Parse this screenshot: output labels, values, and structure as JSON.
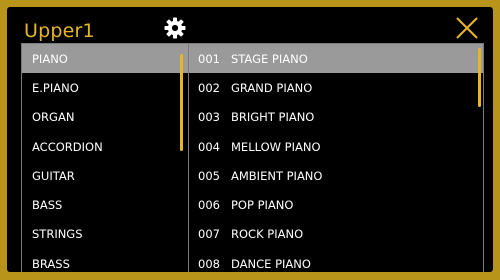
{
  "header": {
    "title": "Upper1",
    "settings_icon": "gear-icon",
    "close_icon": "close-icon",
    "accent_color": "#e6b627"
  },
  "categories": {
    "selected_index": 0,
    "items": [
      {
        "label": "PIANO"
      },
      {
        "label": "E.PIANO"
      },
      {
        "label": "ORGAN"
      },
      {
        "label": "ACCORDION"
      },
      {
        "label": "GUITAR"
      },
      {
        "label": "BASS"
      },
      {
        "label": "STRINGS"
      },
      {
        "label": "BRASS"
      }
    ]
  },
  "tones": {
    "selected_index": 0,
    "items": [
      {
        "number": "001",
        "name": "STAGE PIANO"
      },
      {
        "number": "002",
        "name": "GRAND PIANO"
      },
      {
        "number": "003",
        "name": "BRIGHT PIANO"
      },
      {
        "number": "004",
        "name": "MELLOW PIANO"
      },
      {
        "number": "005",
        "name": "AMBIENT PIANO"
      },
      {
        "number": "006",
        "name": "POP PIANO"
      },
      {
        "number": "007",
        "name": "ROCK PIANO"
      },
      {
        "number": "008",
        "name": "DANCE PIANO"
      }
    ]
  }
}
